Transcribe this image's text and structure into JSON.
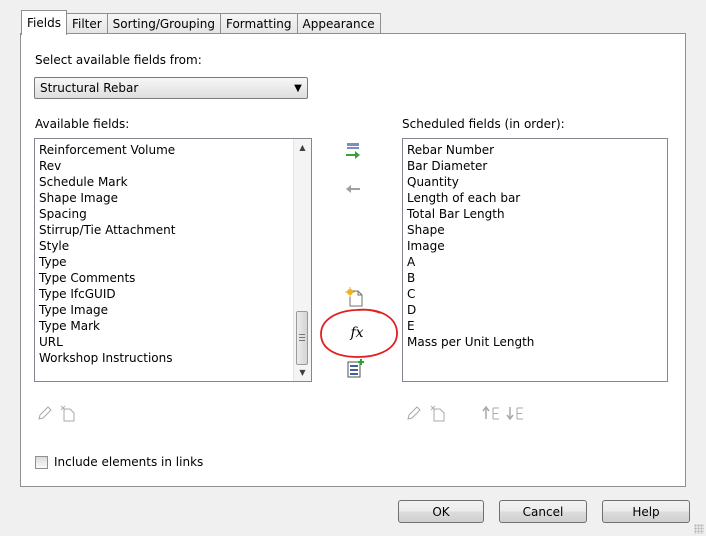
{
  "tabs": [
    {
      "label": "Fields",
      "active": true
    },
    {
      "label": "Filter",
      "active": false
    },
    {
      "label": "Sorting/Grouping",
      "active": false
    },
    {
      "label": "Formatting",
      "active": false
    },
    {
      "label": "Appearance",
      "active": false
    }
  ],
  "select_from": {
    "label": "Select available fields from:",
    "value": "Structural Rebar"
  },
  "available": {
    "label": "Available fields:",
    "items": [
      "Reinforcement Volume",
      "Rev",
      "Schedule Mark",
      "Shape Image",
      "Spacing",
      "Stirrup/Tie Attachment",
      "Style",
      "Type",
      "Type Comments",
      "Type IfcGUID",
      "Type Image",
      "Type Mark",
      "URL",
      "Workshop Instructions"
    ]
  },
  "scheduled": {
    "label": "Scheduled fields (in order):",
    "items": [
      "Rebar Number",
      "Bar Diameter",
      "Quantity",
      "Length of each bar",
      "Total Bar Length",
      "Shape",
      "Image",
      "A",
      "B",
      "C",
      "D",
      "E",
      "Mass per Unit Length"
    ]
  },
  "middle_buttons": {
    "add_icon": "add-parameter-icon",
    "remove_icon": "remove-parameter-icon",
    "new_param_icon": "new-parameter-icon",
    "formula_text": "fx",
    "combine_icon": "combine-parameters-icon"
  },
  "include_links": {
    "label": "Include elements in links",
    "checked": false
  },
  "footer": {
    "ok": "OK",
    "cancel": "Cancel",
    "help": "Help"
  },
  "colors": {
    "annotation_circle": "#e02020",
    "add_arrow_green": "#3ca03c",
    "panel_border": "#8e8f8f"
  }
}
